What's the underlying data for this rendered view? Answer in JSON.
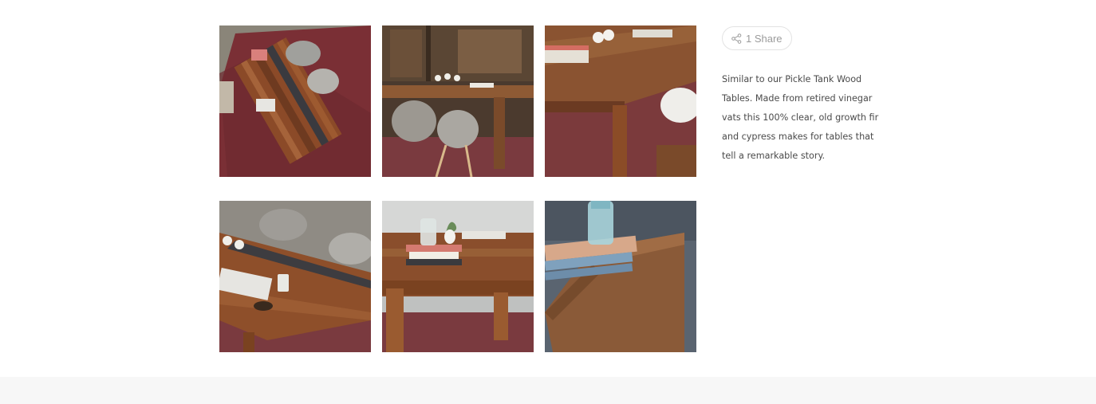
{
  "gallery": {
    "images": [
      {
        "name": "table-top-view-rug"
      },
      {
        "name": "table-with-chairs-workshop"
      },
      {
        "name": "table-corner-closeup"
      },
      {
        "name": "table-with-chairs-mugs"
      },
      {
        "name": "table-books-vase"
      },
      {
        "name": "table-edge-books-jar"
      }
    ]
  },
  "share": {
    "label": "1 Share",
    "icon": "share-icon"
  },
  "description": {
    "text": "Similar to our Pickle Tank Wood Tables. Made from retired vinegar vats this 100% clear, old growth fir and cypress makes for tables that tell a remarkable story."
  },
  "colors": {
    "footer_bg": "#f7f7f7",
    "border": "#e3e3e3",
    "text_muted": "#9b9b9b"
  }
}
